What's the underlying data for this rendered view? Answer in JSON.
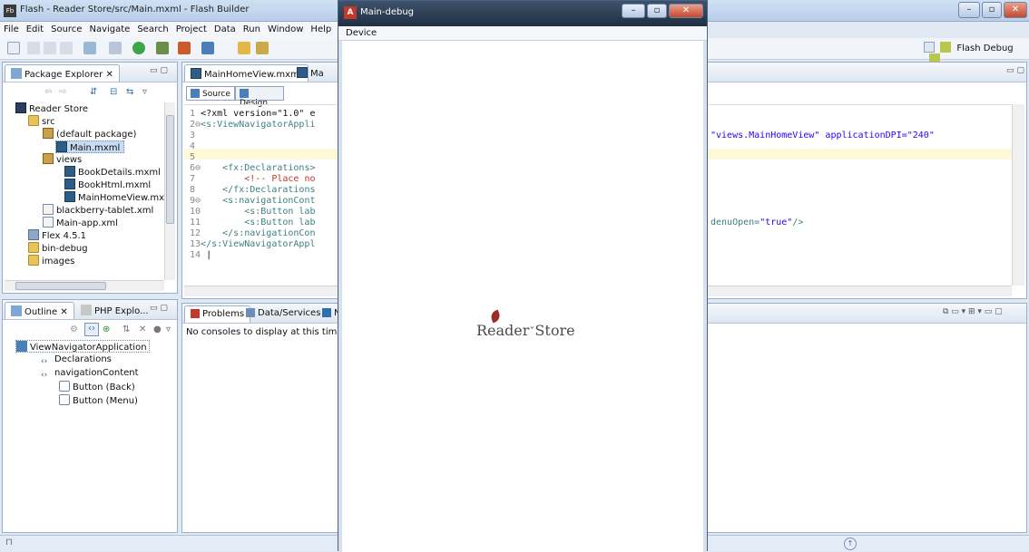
{
  "window": {
    "title": "Flash - Reader Store/src/Main.mxml - Flash Builder",
    "app_icon": "Fb"
  },
  "menu": [
    "File",
    "Edit",
    "Source",
    "Navigate",
    "Search",
    "Project",
    "Data",
    "Run",
    "Window",
    "Help"
  ],
  "perspective": {
    "label": "Flash Debug"
  },
  "package_explorer": {
    "tab_label": "Package Explorer",
    "tree": [
      {
        "label": "Reader Store",
        "icon": "project-icon"
      },
      {
        "label": "src",
        "icon": "source-folder-icon"
      },
      {
        "label": "(default package)",
        "icon": "package-icon"
      },
      {
        "label": "Main.mxml",
        "icon": "mxml-file-icon",
        "selected": true
      },
      {
        "label": "views",
        "icon": "package-icon"
      },
      {
        "label": "BookDetails.mxml",
        "icon": "mxml-file-icon"
      },
      {
        "label": "BookHtml.mxml",
        "icon": "mxml-file-icon"
      },
      {
        "label": "MainHomeView.mx",
        "icon": "mxml-file-icon"
      },
      {
        "label": "blackberry-tablet.xml",
        "icon": "xml-file-icon"
      },
      {
        "label": "Main-app.xml",
        "icon": "xml-file-icon"
      },
      {
        "label": "Flex 4.5.1",
        "icon": "library-icon"
      },
      {
        "label": "bin-debug",
        "icon": "folder-icon"
      },
      {
        "label": "images",
        "icon": "folder-icon"
      }
    ]
  },
  "outline": {
    "tab_label": "Outline",
    "tab2_label": "PHP Explo...",
    "tree": [
      {
        "label": "ViewNavigatorApplication",
        "icon": "app-icon"
      },
      {
        "label": "Declarations",
        "icon": "tag-icon"
      },
      {
        "label": "navigationContent",
        "icon": "tag-icon"
      },
      {
        "label": "Button (Back)",
        "icon": "button-icon"
      },
      {
        "label": "Button (Menu)",
        "icon": "button-icon"
      }
    ]
  },
  "editor": {
    "tabs": [
      "MainHomeView.mxml",
      "Ma"
    ],
    "source_label": "Source",
    "design_label": "Design",
    "lines": [
      {
        "n": "1",
        "text": "<?xml version=\"1.0\" e"
      },
      {
        "n": "2",
        "text": "<s:ViewNavigatorAppli"
      },
      {
        "n": "3",
        "text": ""
      },
      {
        "n": "4",
        "text": ""
      },
      {
        "n": "5",
        "text": ""
      },
      {
        "n": "6",
        "text": "    <fx:Declarations>"
      },
      {
        "n": "7",
        "text": "        <!-- Place no"
      },
      {
        "n": "8",
        "text": "    </fx:Declarations"
      },
      {
        "n": "9",
        "text": "    <s:navigationCont"
      },
      {
        "n": "10",
        "text": "        <s:Button lab"
      },
      {
        "n": "11",
        "text": "        <s:Button lab"
      },
      {
        "n": "12",
        "text": "    </s:navigationCon"
      },
      {
        "n": "13",
        "text": "</s:ViewNavigatorAppl"
      },
      {
        "n": "14",
        "text": ""
      }
    ],
    "right_line3_plain": "\"views.MainHomeView\" applicationDPI=",
    "right_line3_str": "\"240\"",
    "right_line11_plain": "denuOpen=",
    "right_line11_str": "\"true\"",
    "right_line11_end": "/>"
  },
  "console": {
    "tabs": [
      "Problems",
      "Data/Services",
      "N"
    ],
    "message": "No consoles to display at this time."
  },
  "debug_window": {
    "title": "Main-debug",
    "menu_label": "Device",
    "logo_text": "Reader",
    "logo_text2": "Store"
  },
  "colors": {
    "accent": "#9b2a2a"
  }
}
